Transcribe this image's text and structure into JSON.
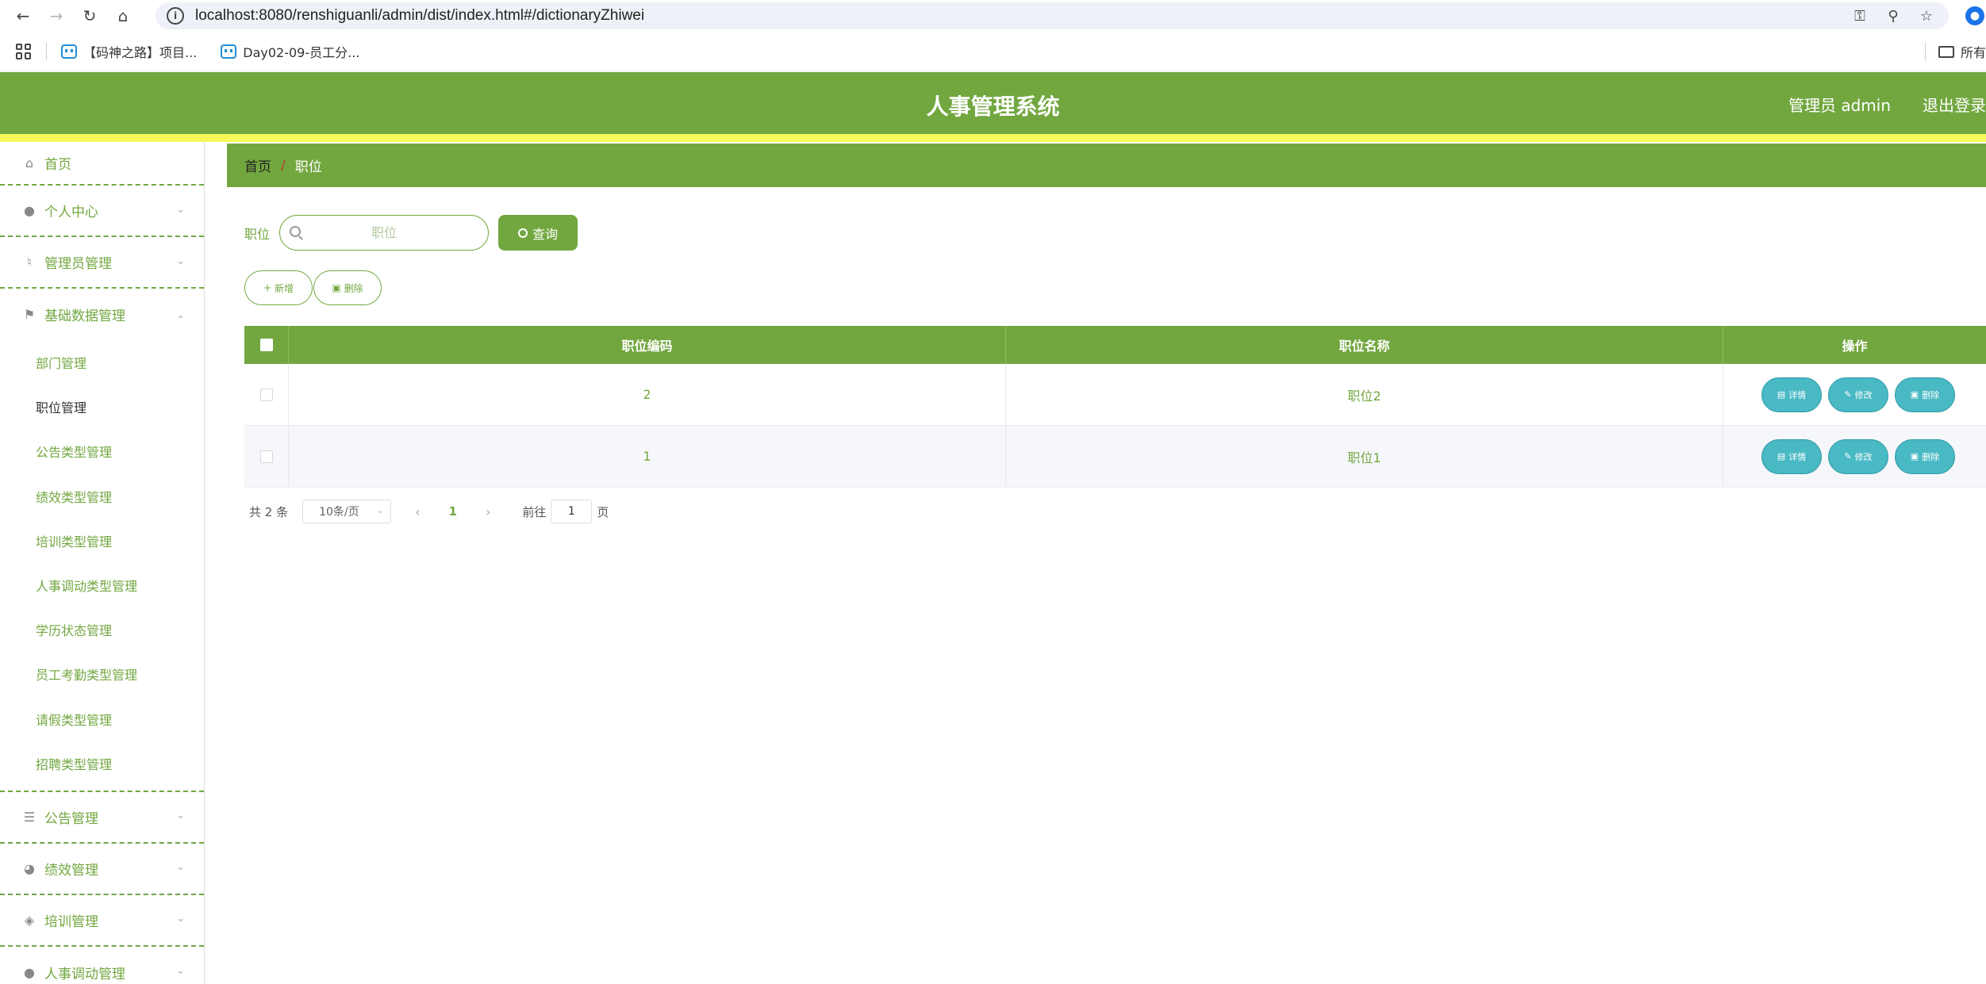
{
  "browser": {
    "url": "localhost:8080/renshiguanli/admin/dist/index.html#/dictionaryZhiwei",
    "bookmarks": [
      "【码神之路】项目...",
      "Day02-09-员工分..."
    ],
    "bookmarks_right": "所有"
  },
  "header": {
    "title": "人事管理系统",
    "user": "管理员 admin",
    "logout": "退出登录"
  },
  "sidebar": {
    "home": "首页",
    "personal_center": "个人中心",
    "admin_mgmt": "管理员管理",
    "basic_data_mgmt": "基础数据管理",
    "sub_items": [
      "部门管理",
      "职位管理",
      "公告类型管理",
      "绩效类型管理",
      "培训类型管理",
      "人事调动类型管理",
      "学历状态管理",
      "员工考勤类型管理",
      "请假类型管理",
      "招聘类型管理"
    ],
    "notice_mgmt": "公告管理",
    "performance_mgmt": "绩效管理",
    "training_mgmt": "培训管理",
    "transfer_mgmt": "人事调动管理"
  },
  "breadcrumb": {
    "home": "首页",
    "separator": "/",
    "current": "职位"
  },
  "search": {
    "label": "职位",
    "placeholder": "职位",
    "button": "查询"
  },
  "actions": {
    "add": "新增",
    "delete": "删除"
  },
  "table": {
    "columns": [
      "职位编码",
      "职位名称",
      "操作"
    ],
    "rows": [
      {
        "code": "2",
        "name": "职位2"
      },
      {
        "code": "1",
        "name": "职位1"
      }
    ],
    "ops": {
      "detail": "详情",
      "edit": "修改",
      "delete": "删除"
    }
  },
  "pagination": {
    "total": "共 2 条",
    "page_size": "10条/页",
    "current_page": "1",
    "goto_prefix": "前往",
    "goto_value": "1",
    "goto_suffix": "页"
  },
  "colors": {
    "primary": "#72a740",
    "accent_strip": "#f6f85a",
    "op_button": "#49b9c4"
  }
}
